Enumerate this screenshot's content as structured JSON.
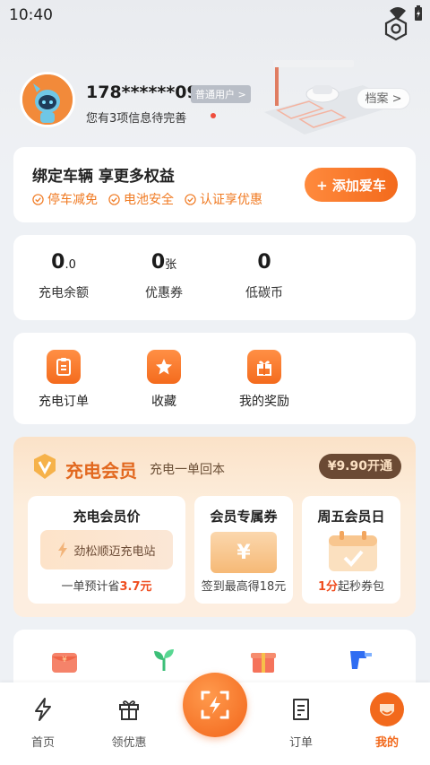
{
  "status_bar": {
    "time": "10:40"
  },
  "profile": {
    "phone": "178******09",
    "user_tag": "普通用户 >",
    "info_hint": "您有3项信息待完善",
    "archive_label": "档案 >"
  },
  "bind_card": {
    "title": "绑定车辆 享更多权益",
    "perks": [
      "停车减免",
      "电池安全",
      "认证享优惠"
    ],
    "add_car_label": "+ 添加爱车"
  },
  "assets": [
    {
      "value": "0",
      "decimal": ".0",
      "unit": "",
      "label": "充电余额"
    },
    {
      "value": "0",
      "decimal": "",
      "unit": "张",
      "label": "优惠券"
    },
    {
      "value": "0",
      "decimal": "",
      "unit": "",
      "label": "低碳币"
    }
  ],
  "shortcuts": [
    {
      "label": "充电订单",
      "icon": "clipboard-icon"
    },
    {
      "label": "收藏",
      "icon": "star-icon"
    },
    {
      "label": "我的奖励",
      "icon": "gift-icon"
    }
  ],
  "member": {
    "title": "充电会员",
    "subtitle": "充电一单回本",
    "open_label": "¥9.90开通",
    "boxes": [
      {
        "title": "充电会员价",
        "pill": "劲松顺迈充电站",
        "bottom_pre": "一单预计省",
        "bottom_hl": "3.7元",
        "bottom_post": ""
      },
      {
        "title": "会员专属券",
        "coupon": "¥",
        "bottom_pre": "签到最高得18元",
        "bottom_hl": "",
        "bottom_post": ""
      },
      {
        "title": "周五会员日",
        "bottom_pre": "",
        "bottom_hl": "1分",
        "bottom_post": "起秒券包"
      }
    ]
  },
  "tabs": [
    {
      "label": "首页",
      "icon": "lightning-icon"
    },
    {
      "label": "领优惠",
      "icon": "gift-icon"
    },
    {
      "label": "订单",
      "icon": "order-icon"
    },
    {
      "label": "我的",
      "icon": "profile-icon",
      "active": true
    }
  ],
  "colors": {
    "accent": "#f2691c",
    "member_brown": "#6b4a34"
  }
}
